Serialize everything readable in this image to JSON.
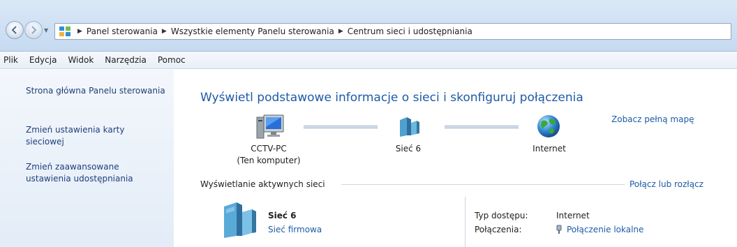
{
  "breadcrumbs": [
    "Panel sterowania",
    "Wszystkie elementy Panelu sterowania",
    "Centrum sieci i udostępniania"
  ],
  "menu": [
    "Plik",
    "Edycja",
    "Widok",
    "Narzędzia",
    "Pomoc"
  ],
  "sidebar": {
    "links": [
      "Strona główna Panelu sterowania",
      "Zmień ustawienia karty sieciowej",
      "Zmień zaawansowane ustawienia udostępniania"
    ]
  },
  "main": {
    "title": "Wyświetl podstawowe informacje o sieci i skonfiguruj połączenia",
    "full_map_link": "Zobacz pełną mapę",
    "map": {
      "computer": {
        "name": "CCTV-PC",
        "sub": "(Ten komputer)",
        "icon": "computer-icon"
      },
      "network": {
        "name": "Sieć 6",
        "icon": "network-icon"
      },
      "internet": {
        "name": "Internet",
        "icon": "globe-icon"
      }
    },
    "active_section": {
      "heading": "Wyświetlanie aktywnych sieci",
      "link": "Połącz lub rozłącz"
    },
    "active_network": {
      "name": "Sieć 6",
      "type": "Sieć firmowa",
      "access_label": "Typ dostępu:",
      "access_value": "Internet",
      "connections_label": "Połączenia:",
      "connections_value": "Połączenie lokalne"
    }
  },
  "colors": {
    "link": "#1d5ba6",
    "title": "#1d5ba6",
    "sidebar_link": "#1e3f7a"
  }
}
